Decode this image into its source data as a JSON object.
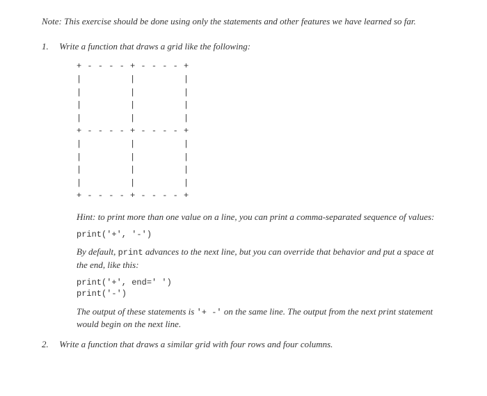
{
  "note": "Note: This exercise should be done using only the statements and other features we have learned so far.",
  "items": [
    {
      "num": "1.",
      "text": "Write a function that draws a grid like the following:"
    },
    {
      "num": "2.",
      "text": "Write a function that draws a similar grid with four rows and four columns."
    }
  ],
  "grid": "+ - - - - + - - - - +\n|         |         |\n|         |         |\n|         |         |\n|         |         |\n+ - - - - + - - - - +\n|         |         |\n|         |         |\n|         |         |\n|         |         |\n+ - - - - + - - - - +",
  "hint": {
    "prefix": "Hint: to print more than one value on a line, you can print a comma-separated sequence of values:"
  },
  "code1": "print('+', '-')",
  "para1_a": "By default, ",
  "para1_code": "print",
  "para1_b": " advances to the next line, but you can override that behavior and put a space at the end, like this:",
  "code2": "print('+', end=' ')\nprint('-')",
  "para2_a": "The output of these statements is ",
  "para2_code": "'+ -'",
  "para2_b": " on the same line. The output from the next print statement would begin on the next line."
}
